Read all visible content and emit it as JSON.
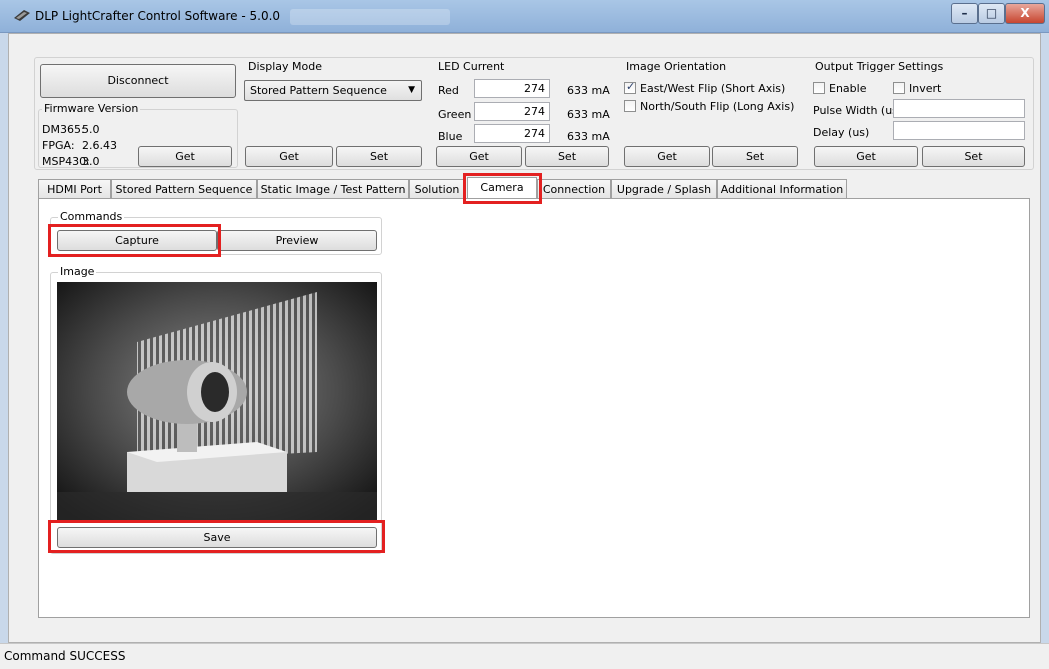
{
  "window": {
    "title": "DLP LightCrafter Control Software - 5.0.0",
    "caption_buttons": {
      "minimize": "–",
      "maximize": "□",
      "close": "X"
    }
  },
  "connection": {
    "disconnect_label": "Disconnect"
  },
  "firmware": {
    "group_label": "Firmware Version",
    "dm365_label": "DM365:",
    "dm365_value": "5.0",
    "fpga_label": "FPGA:",
    "fpga_value": "2.6.43",
    "msp430_label": "MSP430:",
    "msp430_value": "3.0",
    "get_label": "Get"
  },
  "display_mode": {
    "group_label": "Display Mode",
    "selected": "Stored Pattern Sequence",
    "get_label": "Get",
    "set_label": "Set"
  },
  "led_current": {
    "group_label": "LED Current",
    "red_label": "Red",
    "red_value": "274",
    "red_ma": "633 mA",
    "green_label": "Green",
    "green_value": "274",
    "green_ma": "633 mA",
    "blue_label": "Blue",
    "blue_value": "274",
    "blue_ma": "633 mA",
    "get_label": "Get",
    "set_label": "Set"
  },
  "image_orientation": {
    "group_label": "Image Orientation",
    "east_west_label": "East/West Flip (Short Axis)",
    "east_west_checked": true,
    "north_south_label": "North/South Flip (Long Axis)",
    "north_south_checked": false,
    "get_label": "Get",
    "set_label": "Set"
  },
  "output_trigger": {
    "group_label": "Output Trigger Settings",
    "enable_label": "Enable",
    "invert_label": "Invert",
    "pulse_width_label": "Pulse Width (us)",
    "pulse_width_value": "",
    "delay_label": "Delay (us)",
    "delay_value": "",
    "get_label": "Get",
    "set_label": "Set"
  },
  "tabs": [
    {
      "label": "HDMI Port"
    },
    {
      "label": "Stored Pattern Sequence"
    },
    {
      "label": "Static Image / Test Pattern"
    },
    {
      "label": "Solution"
    },
    {
      "label": "Camera"
    },
    {
      "label": "Connection"
    },
    {
      "label": "Upgrade / Splash"
    },
    {
      "label": "Additional Information"
    }
  ],
  "active_tab": "Camera",
  "camera": {
    "commands_label": "Commands",
    "capture_label": "Capture",
    "preview_label": "Preview",
    "image_label": "Image",
    "save_label": "Save"
  },
  "status": {
    "text": "Command SUCCESS"
  },
  "colors": {
    "highlight": "#e32020",
    "titlebar": "#a9c6e6"
  }
}
